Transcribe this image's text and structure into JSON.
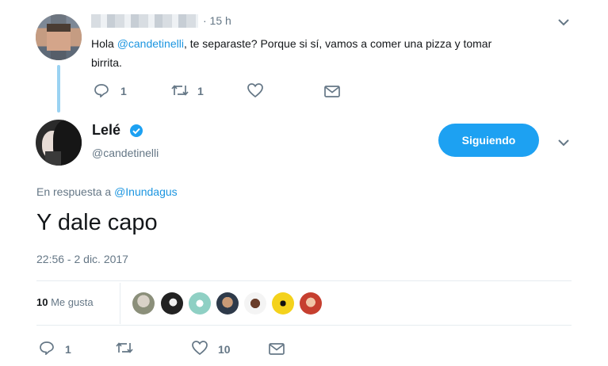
{
  "reply_tweet": {
    "time": "· 15 h",
    "text_before": "Hola ",
    "mention": "@candetinelli",
    "text_after": ", te separaste? Porque si sí, vamos a comer una pizza y tomar",
    "text_line2": "birrita.",
    "actions": {
      "reply_count": "1",
      "retweet_count": "1"
    }
  },
  "main_tweet": {
    "author_name": "Lelé",
    "author_handle": "@candetinelli",
    "follow_button": "Siguiendo",
    "reply_prefix": "En respuesta a ",
    "reply_to": "@Inundagus",
    "text": "Y dale capo",
    "timestamp": "22:56 - 2 dic. 2017",
    "likes_count": "10",
    "likes_label": "Me gusta",
    "actions": {
      "reply_count": "1",
      "like_count": "10"
    }
  },
  "colors": {
    "accent": "#1b95e0",
    "muted": "#657786",
    "divider": "#e6ecf0"
  },
  "icons": [
    "chevron-down-icon",
    "reply-icon",
    "retweet-icon",
    "heart-icon",
    "dm-icon",
    "verified-icon"
  ]
}
